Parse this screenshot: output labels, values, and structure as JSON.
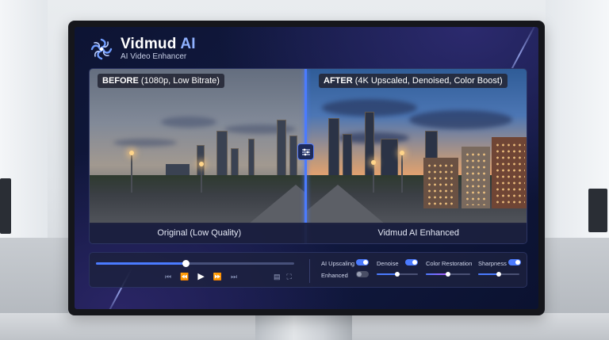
{
  "app": {
    "name": "Vidmud",
    "name_accent": "AI",
    "subtitle": "AI Video Enhancer"
  },
  "comparison": {
    "before_tag_bold": "BEFORE",
    "before_tag_detail": "(1080p, Low Bitrate)",
    "after_tag_bold": "AFTER",
    "after_tag_detail": "(4K Upscaled, Denoised, Color Boost)",
    "before_caption": "Original (Low Quality)",
    "after_caption": "Vidmud AI Enhanced",
    "split_position": 0.49
  },
  "player": {
    "progress": 0.45,
    "controls": [
      "skip-back-icon",
      "rewind-icon",
      "play-icon",
      "fast-forward-icon",
      "skip-forward-icon"
    ],
    "extra_controls": [
      "caption-icon",
      "fullscreen-icon"
    ]
  },
  "enhancements": {
    "ai_upscaling": {
      "label": "AI Upscaling",
      "enabled": true
    },
    "enhanced": {
      "label": "Enhanced",
      "enabled": false
    },
    "denoise": {
      "label": "Denoise",
      "enabled": true,
      "level": 0.5
    },
    "color_restoration": {
      "label": "Color Restoration",
      "level": 0.5
    },
    "sharpness": {
      "label": "Sharpness",
      "enabled": true,
      "level": 0.5
    }
  },
  "colors": {
    "accent": "#4b7bff",
    "brand_accent": "#8fb1ff",
    "color_gradient_start": "#4b7bff",
    "color_gradient_end": "#b05cff"
  }
}
